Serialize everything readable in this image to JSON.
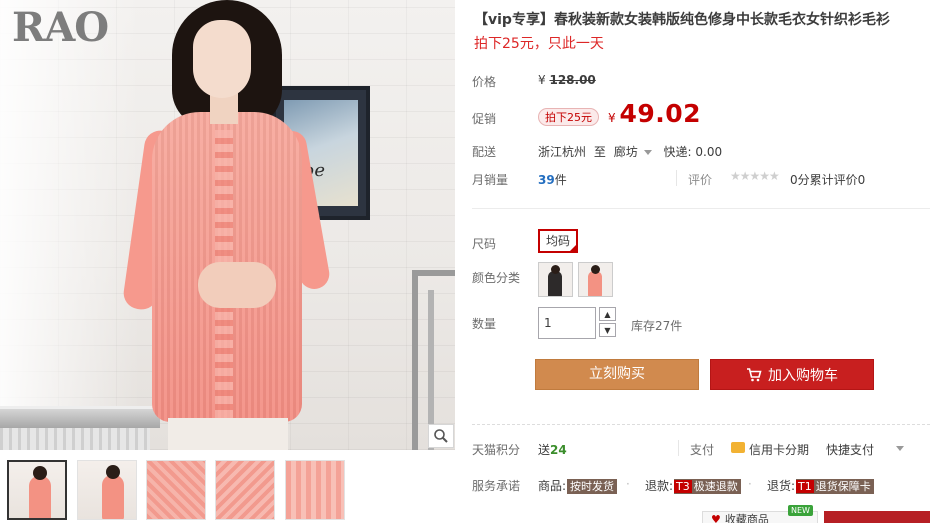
{
  "gallery": {
    "brand_logo": "RAO",
    "frame_text": "obe",
    "zoom_icon": "zoom-icon",
    "thumbnails": [
      {
        "kind": "model-front",
        "active": true
      },
      {
        "kind": "model-side",
        "active": false
      },
      {
        "kind": "knit-detail",
        "active": false
      },
      {
        "kind": "knit-detail",
        "active": false
      },
      {
        "kind": "knit-hem",
        "active": false
      }
    ]
  },
  "product": {
    "title": "【vip专享】春秋装新款女装韩版纯色修身中长款毛衣女针织衫毛衫",
    "subtitle": "拍下25元，只此一天"
  },
  "price": {
    "label": "价格",
    "currency": "¥",
    "original": "128.00"
  },
  "promo": {
    "label": "促销",
    "badge": "拍下25元",
    "currency": "¥",
    "value": "49.02"
  },
  "shipping": {
    "label": "配送",
    "from": "浙江杭州",
    "to_word": "至",
    "to": "廊坊",
    "express": "快递: 0.00"
  },
  "sales": {
    "label": "月销量",
    "count": "39",
    "unit": "件",
    "review_label": "评价",
    "stars": "★★★★★",
    "review_text": "0分累计评价0"
  },
  "size": {
    "label": "尺码",
    "option": "均码"
  },
  "color": {
    "label": "颜色分类",
    "options": [
      {
        "name": "color-option-1",
        "swatch": "#2d2a2a"
      },
      {
        "name": "color-option-2",
        "swatch": "#f39283"
      }
    ]
  },
  "quantity": {
    "label": "数量",
    "value": "1",
    "stock": "库存27件",
    "up_icon": "chevron-up-icon",
    "down_icon": "chevron-down-icon"
  },
  "actions": {
    "buy_now": "立刻购买",
    "add_to_cart": "加入购物车",
    "cart_icon": "cart-icon"
  },
  "points": {
    "label": "天猫积分",
    "prefix": "送",
    "value": "24"
  },
  "payment": {
    "label": "支付",
    "card": "信用卡分期",
    "quick": "快捷支付"
  },
  "service": {
    "label": "服务承诺",
    "items": [
      {
        "prefix": "商品:",
        "code": "",
        "text": "按时发货"
      },
      {
        "prefix": "退款:",
        "code": "T3",
        "text": "极速退款"
      },
      {
        "prefix": "退货:",
        "code": "T1",
        "text": "退货保障卡"
      }
    ]
  },
  "footer": {
    "new_badge": "NEW",
    "favorite_text": "收藏商品"
  },
  "colors": {
    "accent_red": "#c40000",
    "buy_button": "#d18a4e",
    "cart_button": "#c81f1f",
    "sales_blue": "#236ec0",
    "points_green": "#3b8e2c"
  }
}
